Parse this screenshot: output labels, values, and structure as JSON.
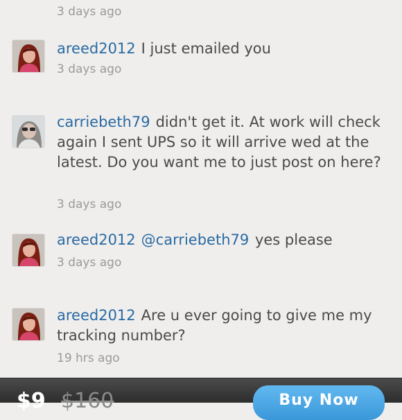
{
  "comments": [
    {
      "time": "3 days ago"
    },
    {
      "user": "areed2012",
      "text": "I just emailed you",
      "time": "3 days ago",
      "avatar_icon": "user-avatar-red-hair"
    },
    {
      "user": "carriebeth79",
      "text": "didn't get it. At work will check again I sent UPS so it will arrive wed at the latest. Do you want me to just post on here?",
      "time": "3 days ago",
      "avatar_icon": "user-avatar-sunglasses"
    },
    {
      "user": "areed2012",
      "mention": "@carriebeth79",
      "text": "yes please",
      "time": "3 days ago",
      "avatar_icon": "user-avatar-red-hair"
    },
    {
      "user": "areed2012",
      "text": "Are u ever going to give me my tracking number?",
      "time": "19 hrs ago",
      "avatar_icon": "user-avatar-red-hair"
    }
  ],
  "bottom_bar": {
    "price": "$9",
    "original_price": "$160",
    "buy_label": "Buy Now"
  },
  "colors": {
    "background": "#efeeec",
    "username": "#2a6aa3",
    "timestamp": "#9a9a9a",
    "buy_button": "#3a97d8"
  }
}
